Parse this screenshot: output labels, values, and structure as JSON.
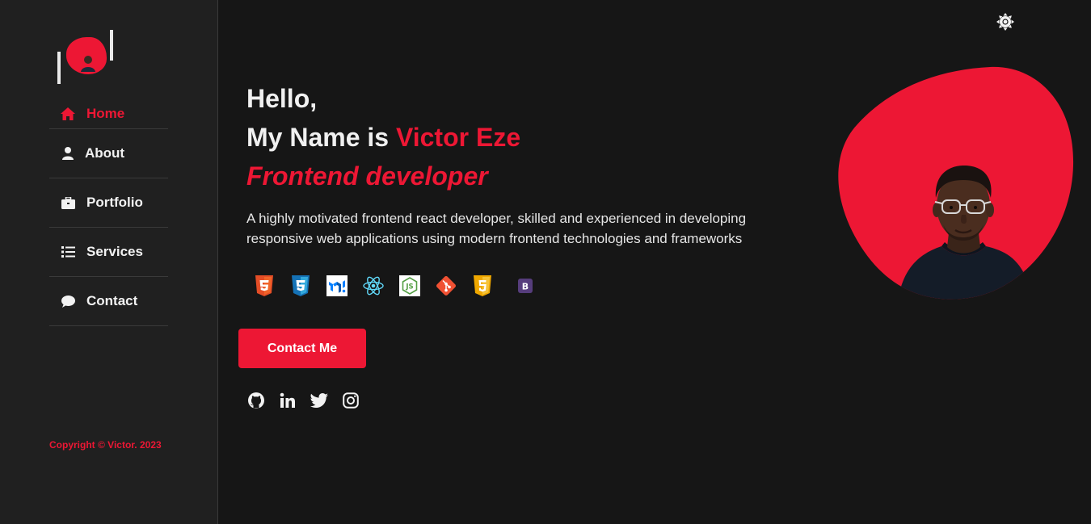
{
  "sidebar": {
    "items": [
      {
        "label": "Home",
        "icon": "home-icon",
        "active": true
      },
      {
        "label": "About",
        "icon": "user-icon"
      },
      {
        "label": "Portfolio",
        "icon": "briefcase-icon"
      },
      {
        "label": "Services",
        "icon": "list-icon"
      },
      {
        "label": "Contact",
        "icon": "chat-icon"
      }
    ],
    "copyright": "Copyright © Victor. 2023"
  },
  "header": {
    "theme_toggle_icon": "sun-icon"
  },
  "hero": {
    "hello": "Hello,",
    "name_prefix": "My Name is",
    "name": "Victor Eze",
    "role": "Frontend developer",
    "description": "A highly motivated frontend react developer, skilled and experienced in developing responsive web applications using modern frontend technologies and frameworks",
    "tech_icons": [
      "html5-icon",
      "css3-icon",
      "mui-icon",
      "react-icon",
      "nodejs-icon",
      "git-icon",
      "sass-icon",
      "bootstrap-icon"
    ],
    "cta_label": "Contact Me",
    "social_icons": [
      "github-icon",
      "linkedin-icon",
      "twitter-icon",
      "instagram-icon"
    ]
  },
  "colors": {
    "accent": "#ed1734",
    "background": "#161616",
    "sidebar": "#202020",
    "text": "#f0f0f0"
  }
}
